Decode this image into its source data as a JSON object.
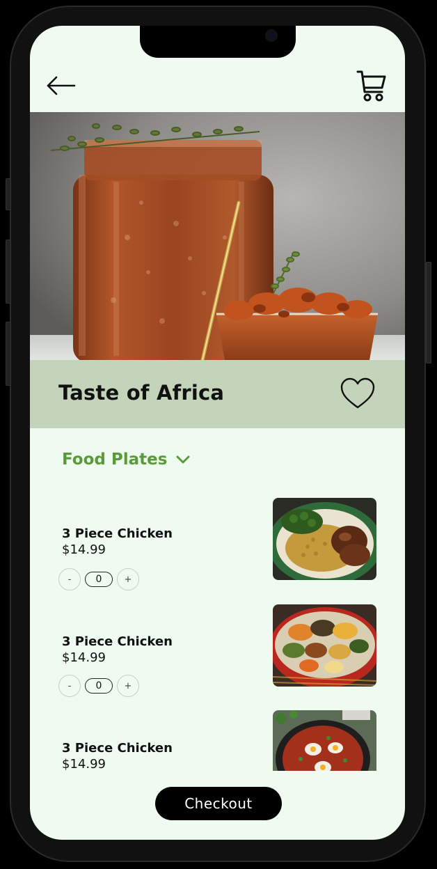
{
  "header": {
    "back_icon": "arrow-left-icon",
    "cart_icon": "shopping-cart-icon"
  },
  "hero": {
    "image": "hero-food-photo"
  },
  "restaurant": {
    "name": "Taste of Africa",
    "favorite_icon": "heart-outline-icon"
  },
  "category": {
    "label": "Food Plates",
    "icon": "chevron-down-icon"
  },
  "menu": {
    "items": [
      {
        "name": "3 Piece Chicken",
        "price": "$14.99",
        "quantity": "0",
        "decrement": "-",
        "increment": "+"
      },
      {
        "name": "3 Piece Chicken",
        "price": "$14.99",
        "quantity": "0",
        "decrement": "-",
        "increment": "+"
      },
      {
        "name": "3 Piece Chicken",
        "price": "$14.99"
      }
    ]
  },
  "checkout": {
    "label": "Checkout"
  },
  "colors": {
    "screen_bg": "#effbf0",
    "title_band": "#c3d4ba",
    "accent_green": "#5a9a3a",
    "button_black": "#000000"
  }
}
